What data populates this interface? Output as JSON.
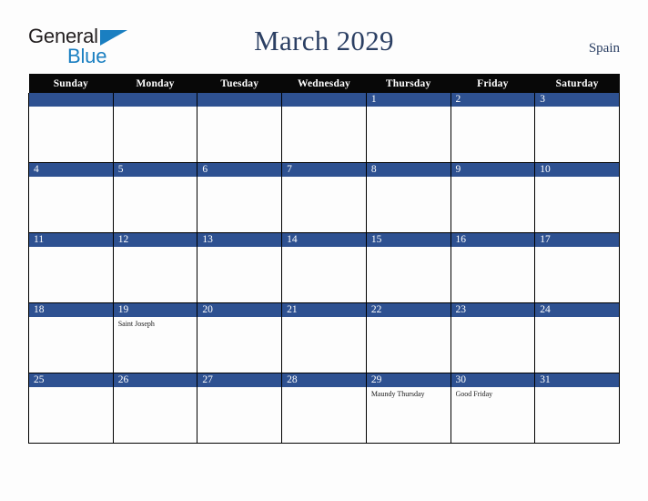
{
  "brand": {
    "name_part1": "General",
    "name_part2": "Blue",
    "triangle_icon": "triangle-icon",
    "color_dark": "#231f20",
    "color_blue": "#1a7fc1"
  },
  "header": {
    "title": "March 2029",
    "country": "Spain",
    "title_color": "#2b3f63"
  },
  "calendar": {
    "accent_color": "#2e5191",
    "header_bg": "#080808",
    "weekdays": [
      "Sunday",
      "Monday",
      "Tuesday",
      "Wednesday",
      "Thursday",
      "Friday",
      "Saturday"
    ],
    "weeks": [
      [
        {
          "day": "",
          "events": []
        },
        {
          "day": "",
          "events": []
        },
        {
          "day": "",
          "events": []
        },
        {
          "day": "",
          "events": []
        },
        {
          "day": "1",
          "events": []
        },
        {
          "day": "2",
          "events": []
        },
        {
          "day": "3",
          "events": []
        }
      ],
      [
        {
          "day": "4",
          "events": []
        },
        {
          "day": "5",
          "events": []
        },
        {
          "day": "6",
          "events": []
        },
        {
          "day": "7",
          "events": []
        },
        {
          "day": "8",
          "events": []
        },
        {
          "day": "9",
          "events": []
        },
        {
          "day": "10",
          "events": []
        }
      ],
      [
        {
          "day": "11",
          "events": []
        },
        {
          "day": "12",
          "events": []
        },
        {
          "day": "13",
          "events": []
        },
        {
          "day": "14",
          "events": []
        },
        {
          "day": "15",
          "events": []
        },
        {
          "day": "16",
          "events": []
        },
        {
          "day": "17",
          "events": []
        }
      ],
      [
        {
          "day": "18",
          "events": []
        },
        {
          "day": "19",
          "events": [
            "Saint Joseph"
          ]
        },
        {
          "day": "20",
          "events": []
        },
        {
          "day": "21",
          "events": []
        },
        {
          "day": "22",
          "events": []
        },
        {
          "day": "23",
          "events": []
        },
        {
          "day": "24",
          "events": []
        }
      ],
      [
        {
          "day": "25",
          "events": []
        },
        {
          "day": "26",
          "events": []
        },
        {
          "day": "27",
          "events": []
        },
        {
          "day": "28",
          "events": []
        },
        {
          "day": "29",
          "events": [
            "Maundy Thursday"
          ]
        },
        {
          "day": "30",
          "events": [
            "Good Friday"
          ]
        },
        {
          "day": "31",
          "events": []
        }
      ]
    ]
  }
}
